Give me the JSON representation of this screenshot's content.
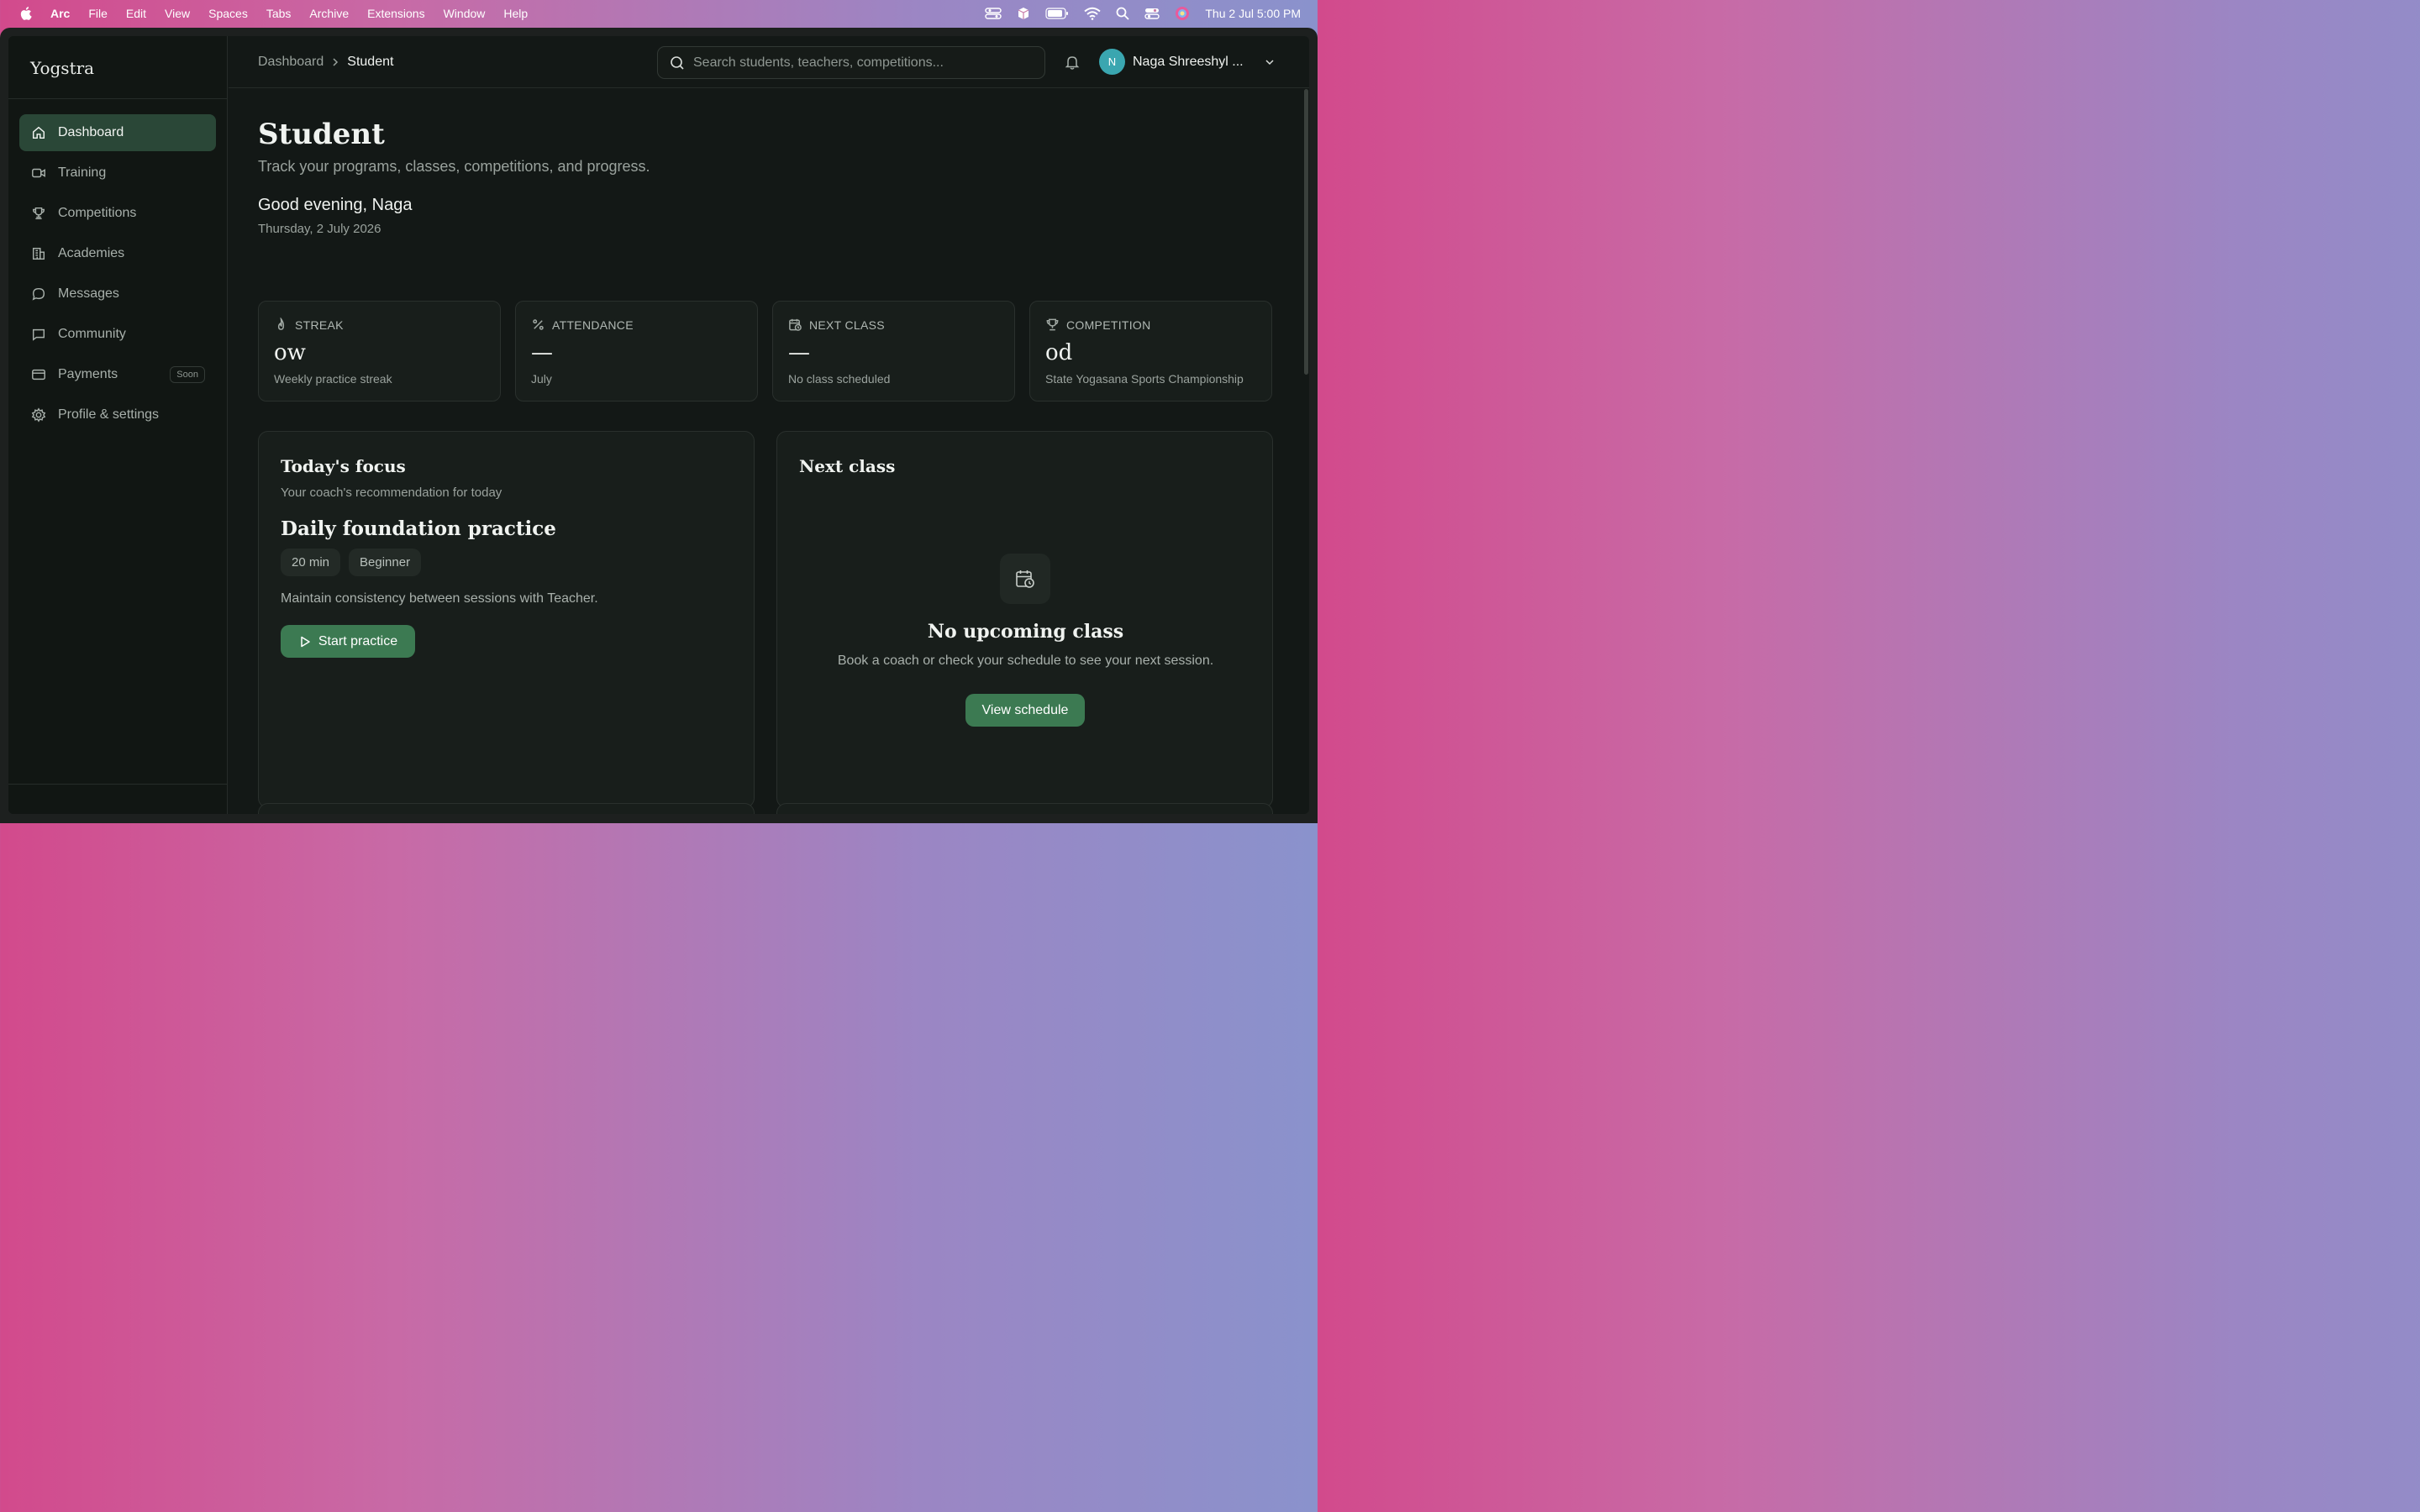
{
  "menubar": {
    "app": "Arc",
    "items": [
      "File",
      "Edit",
      "View",
      "Spaces",
      "Tabs",
      "Archive",
      "Extensions",
      "Window",
      "Help"
    ],
    "clock": "Thu 2 Jul  5:00 PM"
  },
  "sidebar": {
    "logo": "Yogstra",
    "items": [
      {
        "label": "Dashboard",
        "icon": "home-icon",
        "active": true
      },
      {
        "label": "Training",
        "icon": "video-icon"
      },
      {
        "label": "Competitions",
        "icon": "trophy-icon"
      },
      {
        "label": "Academies",
        "icon": "building-icon"
      },
      {
        "label": "Messages",
        "icon": "chat-bubble-icon"
      },
      {
        "label": "Community",
        "icon": "message-square-icon"
      },
      {
        "label": "Payments",
        "icon": "credit-card-icon",
        "badge": "Soon"
      },
      {
        "label": "Profile & settings",
        "icon": "gear-icon"
      }
    ]
  },
  "topbar": {
    "breadcrumb": [
      "Dashboard",
      "Student"
    ],
    "search_placeholder": "Search students, teachers, competitions...",
    "user_initial": "N",
    "user_name": "Naga Shreeshyl ..."
  },
  "page": {
    "title": "Student",
    "subtitle": "Track your programs, classes, competitions, and progress.",
    "greeting": "Good evening, Naga",
    "date": "Thursday, 2 July 2026"
  },
  "stats": [
    {
      "label": "STREAK",
      "icon": "flame-icon",
      "value": "ow",
      "note": "Weekly practice streak"
    },
    {
      "label": "ATTENDANCE",
      "icon": "percent-icon",
      "value": "—",
      "note": "July"
    },
    {
      "label": "NEXT CLASS",
      "icon": "calendar-clock-icon",
      "value": "—",
      "note": "No class scheduled"
    },
    {
      "label": "COMPETITION",
      "icon": "trophy-icon",
      "value": "od",
      "note": "State Yogasana Sports Championship"
    }
  ],
  "focus": {
    "title": "Today's focus",
    "subtitle": "Your coach's recommendation for today",
    "practice_title": "Daily foundation practice",
    "chips": [
      "20 min",
      "Beginner"
    ],
    "description": "Maintain consistency between sessions with Teacher.",
    "button": "Start practice"
  },
  "next_class": {
    "title": "Next class",
    "empty_title": "No upcoming class",
    "empty_desc": "Book a coach or check your schedule to see your next session.",
    "button": "View schedule"
  },
  "colors": {
    "accent": "#3c7a52",
    "active_nav": "#2a4737",
    "background": "#131816",
    "avatar": "#3aa6b0"
  }
}
